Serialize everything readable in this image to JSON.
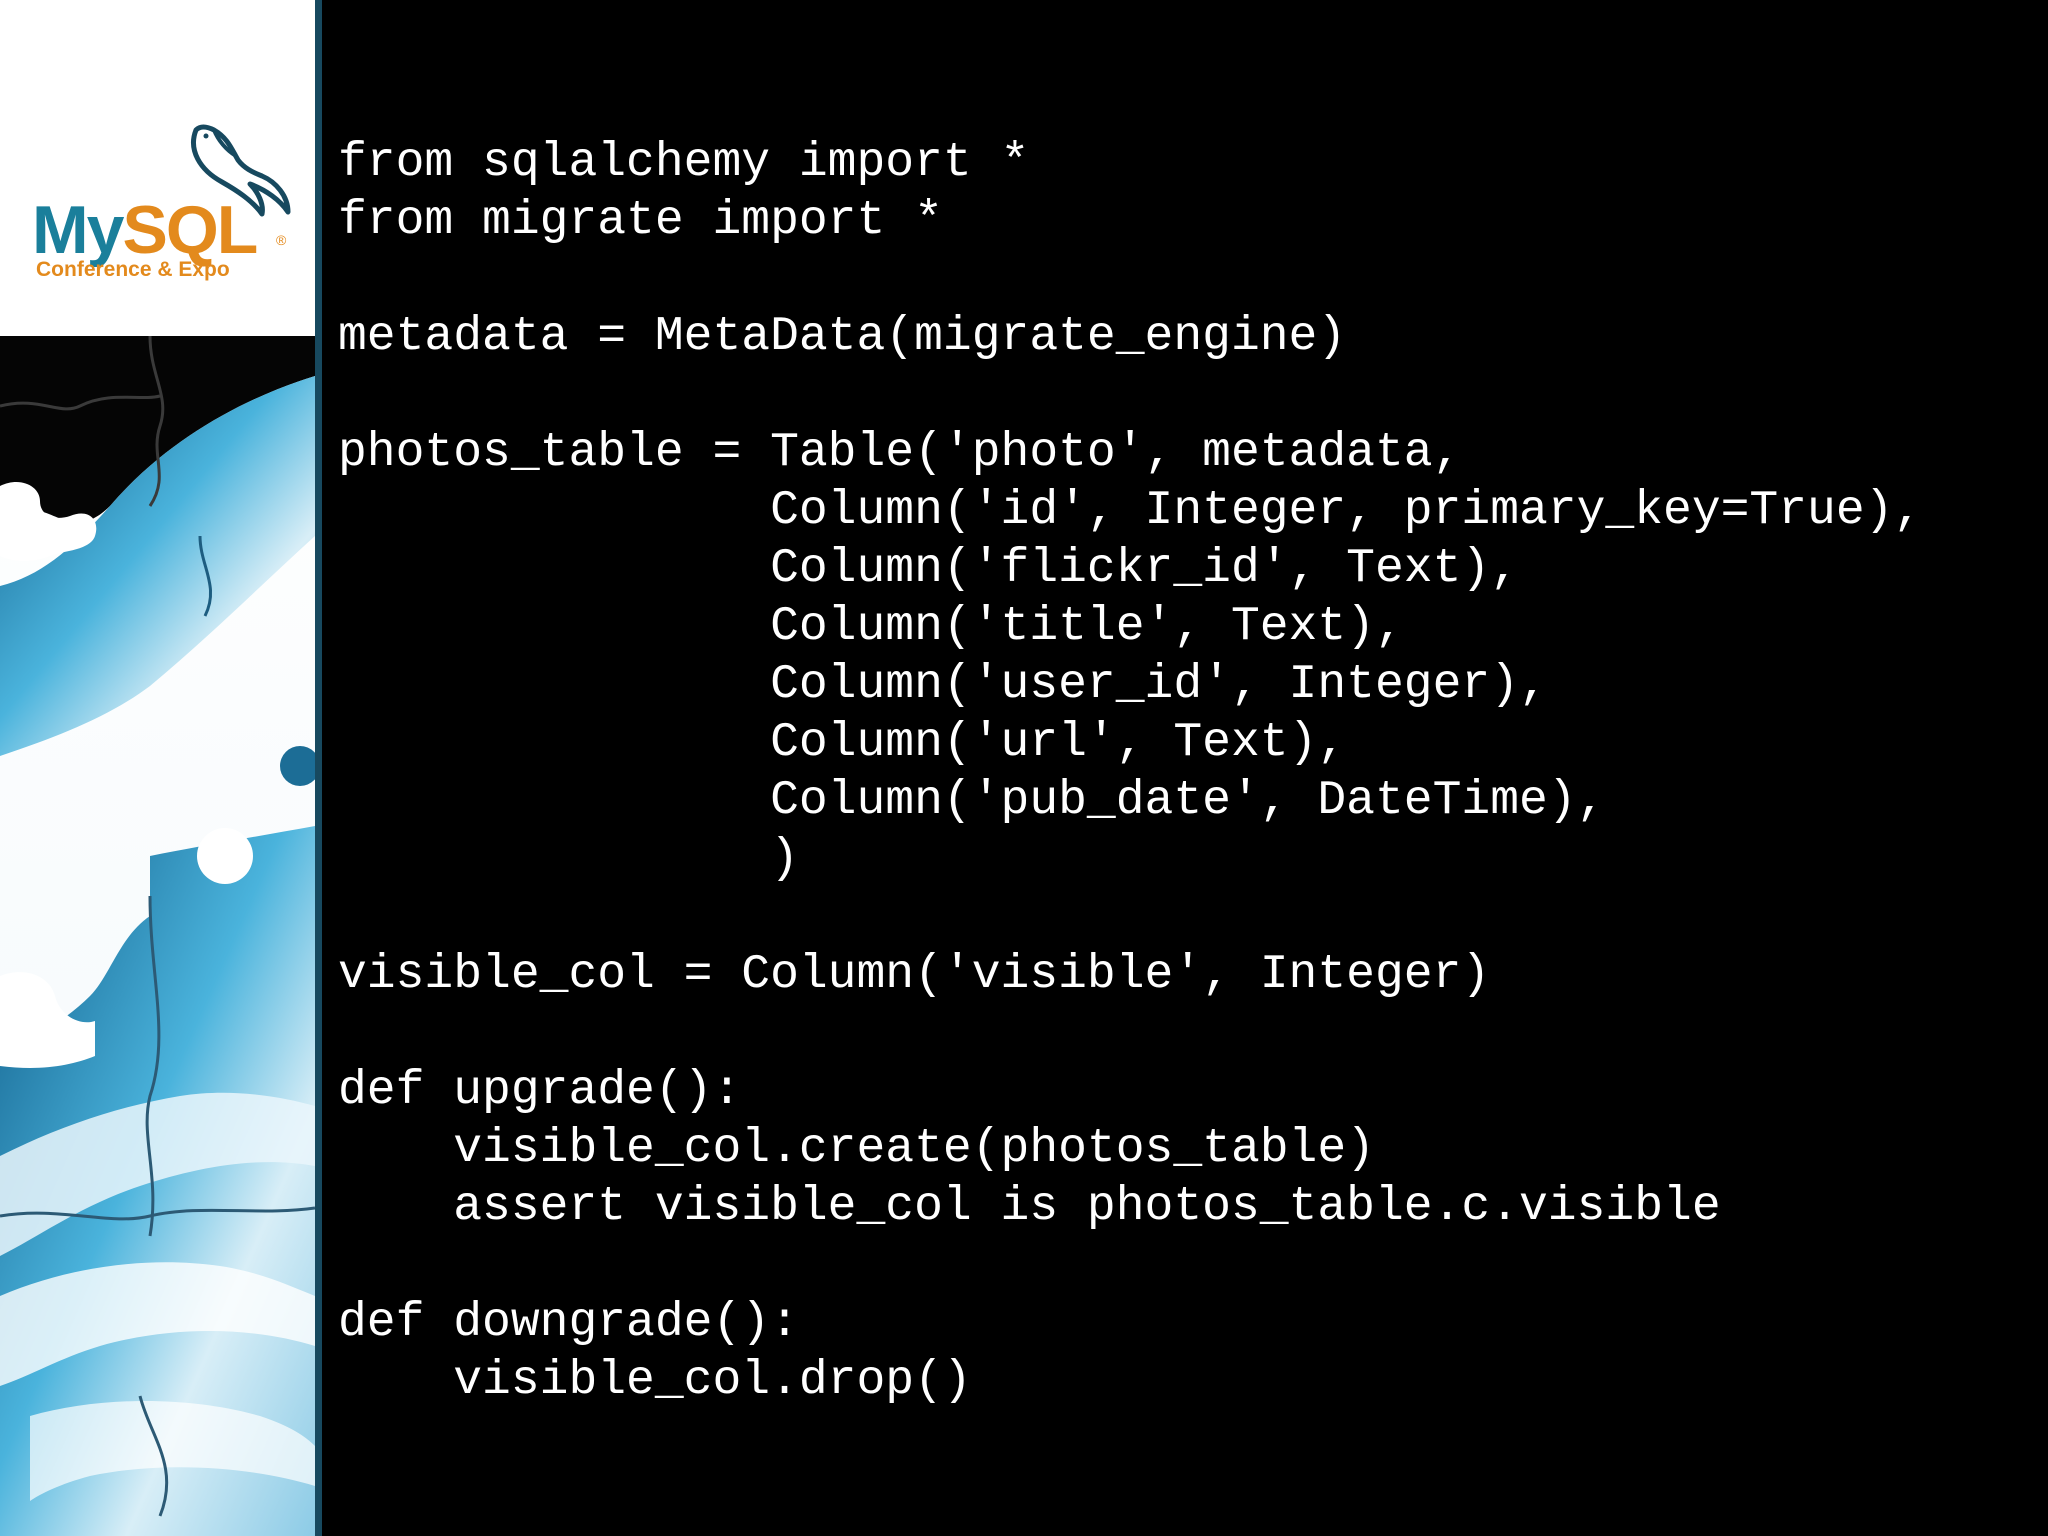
{
  "logo": {
    "brand_my": "My",
    "brand_sql": "SQL",
    "registered": "®",
    "subtitle": "Conference & Expo"
  },
  "code_lines": [
    "from sqlalchemy import *",
    "from migrate import *",
    "",
    "metadata = MetaData(migrate_engine)",
    "",
    "photos_table = Table('photo', metadata,",
    "               Column('id', Integer, primary_key=True),",
    "               Column('flickr_id', Text),",
    "               Column('title', Text),",
    "               Column('user_id', Integer),",
    "               Column('url', Text),",
    "               Column('pub_date', DateTime),",
    "               )",
    "",
    "visible_col = Column('visible', Integer)",
    "",
    "def upgrade():",
    "    visible_col.create(photos_table)",
    "    assert visible_col is photos_table.c.visible",
    "",
    "def downgrade():",
    "    visible_col.drop()"
  ],
  "colors": {
    "background": "#000000",
    "code_text": "#ffffff",
    "brand_blue": "#1a7f9b",
    "brand_orange": "#e38a1d",
    "sidebar_accent": "#17495f"
  },
  "icons": {
    "logo_mark": "dolphin-icon",
    "sidebar_art": "puzzle-earth-image"
  }
}
